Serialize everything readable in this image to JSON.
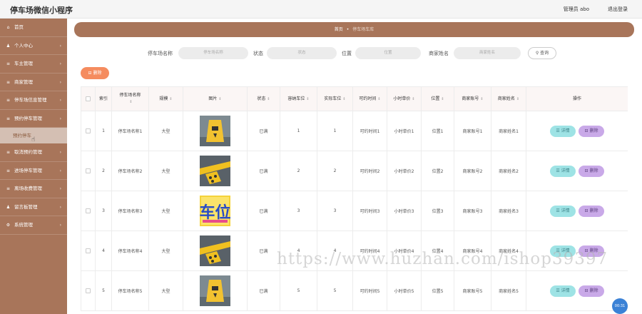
{
  "app": {
    "title": "停车场微信小程序",
    "admin": "管理员 abo",
    "logout": "退出登录"
  },
  "sidebar": {
    "items": [
      {
        "label": "首页",
        "icon": "home-icon",
        "glyph": "⌂",
        "chevron": false
      },
      {
        "label": "个人中心",
        "icon": "user-icon",
        "glyph": "♟",
        "chevron": true
      },
      {
        "label": "车主管理",
        "icon": "list-icon",
        "glyph": "≡",
        "chevron": true
      },
      {
        "label": "商家管理",
        "icon": "list-icon",
        "glyph": "≡",
        "chevron": true
      },
      {
        "label": "停车场信息管理",
        "icon": "list-icon",
        "glyph": "≡",
        "chevron": true
      },
      {
        "label": "预约停车管理",
        "icon": "list-icon",
        "glyph": "≡",
        "chevron": true
      }
    ],
    "sub_item": "预约停车",
    "items_after": [
      {
        "label": "取消预约管理",
        "icon": "list-icon",
        "glyph": "≡",
        "chevron": true
      },
      {
        "label": "进场停车管理",
        "icon": "list-icon",
        "glyph": "≡",
        "chevron": true
      },
      {
        "label": "离场收费管理",
        "icon": "list-icon",
        "glyph": "≡",
        "chevron": true
      },
      {
        "label": "留言板管理",
        "icon": "chat-icon",
        "glyph": "♟",
        "chevron": true
      },
      {
        "label": "系统管理",
        "icon": "settings-icon",
        "glyph": "⚙",
        "chevron": true
      }
    ]
  },
  "breadcrumb": {
    "home": "首页",
    "separator": "•",
    "current": "停车场车库"
  },
  "search": {
    "name_label": "停车场名称",
    "name_placeholder": "停车场名称",
    "status_label": "状态",
    "status_placeholder": "状态",
    "location_label": "位置",
    "location_placeholder": "位置",
    "merchant_label": "商家姓名",
    "merchant_placeholder": "商家姓名",
    "search_button": "查询"
  },
  "toolbar": {
    "delete_label": "删除"
  },
  "table": {
    "headers": {
      "index": "索引",
      "name": "停车场名称",
      "size": "规模",
      "image": "图片",
      "status": "状态",
      "total": "容纳车位",
      "actual": "实际车位",
      "time": "可约时间",
      "unit": "小时单价",
      "location": "位置",
      "account": "商家账号",
      "merchant": "商家姓名",
      "actions": "操作"
    },
    "sort_glyph": "⇕",
    "detail_label": "详情",
    "delete_label": "删除",
    "rows": [
      {
        "index": "1",
        "name": "停车场名称1",
        "size": "大型",
        "status": "已满",
        "total": "1",
        "actual": "1",
        "time": "可约时间1",
        "unit": "小时单价1",
        "location": "位置1",
        "account": "商家账号1",
        "merchant": "商家姓名1",
        "image": "wet-floor-sign"
      },
      {
        "index": "2",
        "name": "停车场名称2",
        "size": "大型",
        "status": "已满",
        "total": "2",
        "actual": "2",
        "time": "可约时间2",
        "unit": "小时单价2",
        "location": "位置2",
        "account": "商家账号2",
        "merchant": "商家姓名2",
        "image": "parking-bay"
      },
      {
        "index": "3",
        "name": "停车场名称3",
        "size": "大型",
        "status": "已满",
        "total": "3",
        "actual": "3",
        "time": "可约时间3",
        "unit": "小时单价3",
        "location": "位置3",
        "account": "商家账号3",
        "merchant": "商家姓名3",
        "image": "parking-sign"
      },
      {
        "index": "4",
        "name": "停车场名称4",
        "size": "大型",
        "status": "已满",
        "total": "4",
        "actual": "4",
        "time": "可约时间4",
        "unit": "小时单价4",
        "location": "位置4",
        "account": "商家账号4",
        "merchant": "商家姓名4",
        "image": "parking-bay"
      },
      {
        "index": "5",
        "name": "停车场名称5",
        "size": "大型",
        "status": "已满",
        "total": "5",
        "actual": "5",
        "time": "可约时间5",
        "unit": "小时单价5",
        "location": "位置5",
        "account": "商家账号5",
        "merchant": "商家姓名5",
        "image": "wet-floor-sign"
      }
    ]
  },
  "badge": "00:31",
  "watermark": "https://www.huzhan.com/ishop39397",
  "colors": {
    "sidebar": "#a8755a",
    "accent": "#f58c5f",
    "detail": "#9ee3e5",
    "delete": "#c9a9e8"
  }
}
